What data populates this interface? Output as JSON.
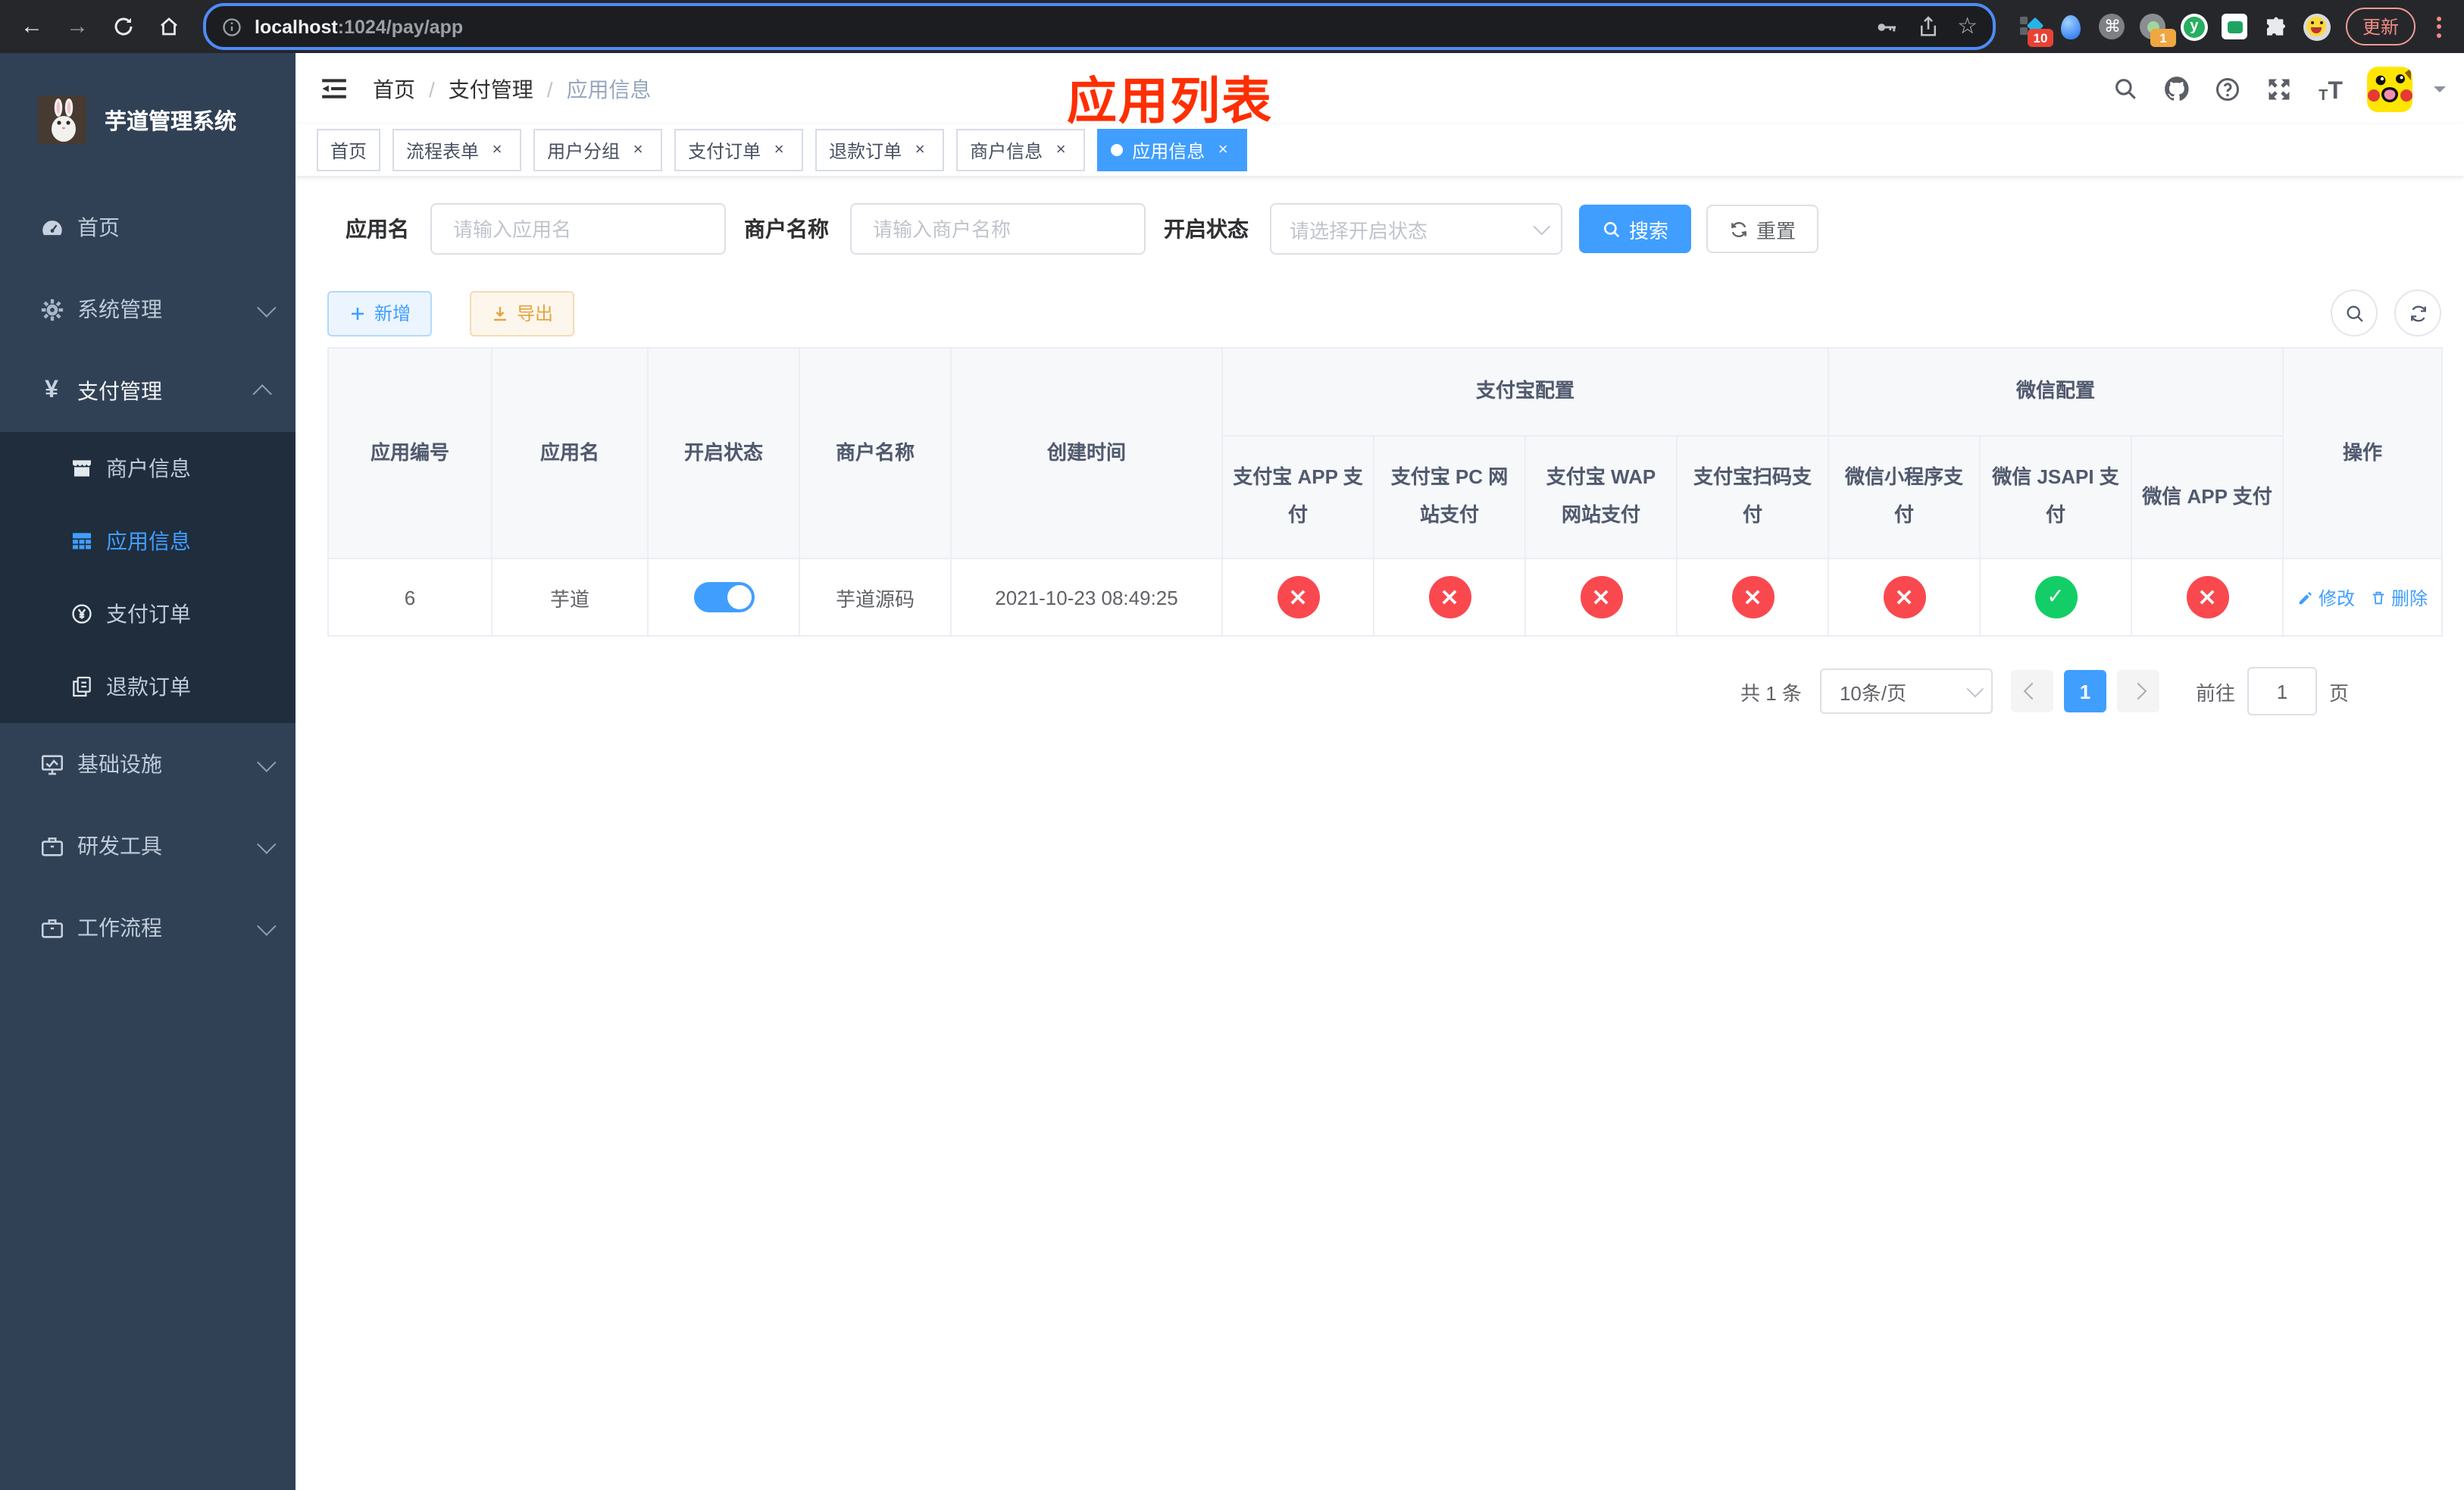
{
  "glyphs": {
    "back": "←",
    "forward": "→",
    "reload": "⟳",
    "home": "⌂",
    "star": "☆",
    "cmd": "⌘",
    "slash": "/",
    "close": "×",
    "plus": "＋",
    "y_logo": "y",
    "t_letter": "T",
    "prev": "‹",
    "next": "›",
    "yen": "¥"
  },
  "browser": {
    "url_host": "localhost",
    "url_rest": ":1024/pay/app",
    "ext_badge_blocks": "10",
    "ext_badge_dot": "1",
    "update_label": "更新"
  },
  "sidebar": {
    "title": "芋道管理系统",
    "menu": [
      {
        "label": "首页"
      },
      {
        "label": "系统管理"
      },
      {
        "label": "支付管理"
      }
    ],
    "submenu": [
      {
        "label": "商户信息"
      },
      {
        "label": "应用信息"
      },
      {
        "label": "支付订单"
      },
      {
        "label": "退款订单"
      }
    ],
    "menu_lower": [
      {
        "label": "基础设施"
      },
      {
        "label": "研发工具"
      },
      {
        "label": "工作流程"
      }
    ]
  },
  "header": {
    "breadcrumb": [
      "首页",
      "支付管理",
      "应用信息"
    ],
    "annotation": "应用列表"
  },
  "tags": [
    {
      "label": "首页"
    },
    {
      "label": "流程表单"
    },
    {
      "label": "用户分组"
    },
    {
      "label": "支付订单"
    },
    {
      "label": "退款订单"
    },
    {
      "label": "商户信息"
    },
    {
      "label": "应用信息"
    }
  ],
  "filters": {
    "app_name_label": "应用名",
    "app_name_placeholder": "请输入应用名",
    "merchant_label": "商户名称",
    "merchant_placeholder": "请输入商户名称",
    "status_label": "开启状态",
    "status_placeholder": "请选择开启状态",
    "search_label": "搜索",
    "reset_label": "重置"
  },
  "toolbar": {
    "add_label": "新增",
    "export_label": "导出"
  },
  "table": {
    "col_id": "应用编号",
    "col_name": "应用名",
    "col_status": "开启状态",
    "col_merchant": "商户名称",
    "col_created": "创建时间",
    "group_alipay": "支付宝配置",
    "group_wechat": "微信配置",
    "pay_cols": [
      "支付宝 APP 支付",
      "支付宝 PC 网站支付",
      "支付宝 WAP 网站支付",
      "支付宝扫码支付",
      "微信小程序支付",
      "微信 JSAPI 支付",
      "微信 APP 支付"
    ],
    "col_actions": "操作",
    "row": {
      "id": "6",
      "name": "芋道",
      "merchant": "芋道源码",
      "created": "2021-10-23 08:49:25",
      "statuses": [
        "no",
        "no",
        "no",
        "no",
        "no",
        "yes",
        "no"
      ],
      "edit_label": "修改",
      "delete_label": "删除"
    }
  },
  "pagination": {
    "total": "共 1 条",
    "page_size": "10条/页",
    "page": "1",
    "goto_label": "前往",
    "goto_value": "1",
    "goto_unit": "页"
  }
}
